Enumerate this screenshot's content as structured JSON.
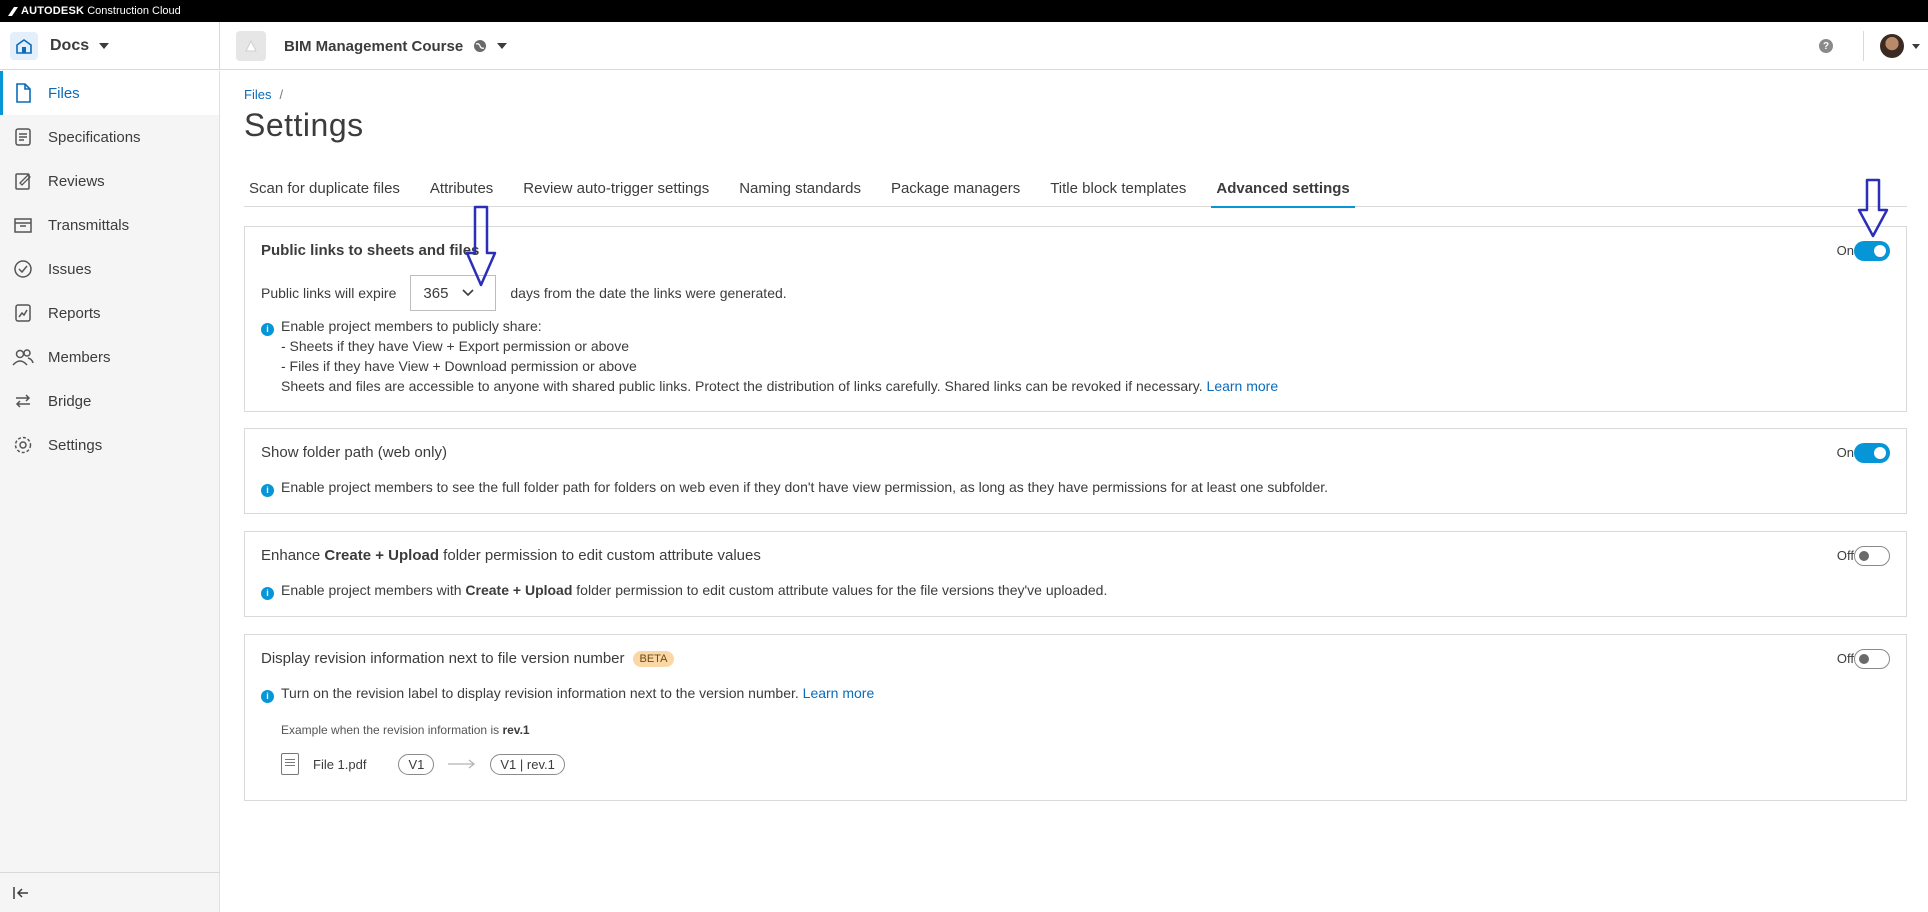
{
  "brand": {
    "strong": "AUTODESK",
    "rest": "Construction Cloud"
  },
  "header": {
    "app_name": "Docs",
    "project_name": "BIM Management Course"
  },
  "sidebar": {
    "items": [
      {
        "label": "Files",
        "icon": "file-icon"
      },
      {
        "label": "Specifications",
        "icon": "specifications-icon"
      },
      {
        "label": "Reviews",
        "icon": "reviews-icon"
      },
      {
        "label": "Transmittals",
        "icon": "transmittals-icon"
      },
      {
        "label": "Issues",
        "icon": "issues-icon"
      },
      {
        "label": "Reports",
        "icon": "reports-icon"
      },
      {
        "label": "Members",
        "icon": "members-icon"
      },
      {
        "label": "Bridge",
        "icon": "bridge-icon"
      },
      {
        "label": "Settings",
        "icon": "settings-icon"
      }
    ],
    "active": "Files"
  },
  "breadcrumb": {
    "root": "Files",
    "sep": "/"
  },
  "page_title": "Settings",
  "tabs": [
    "Scan for duplicate files",
    "Attributes",
    "Review auto-trigger settings",
    "Naming standards",
    "Package managers",
    "Title block templates",
    "Advanced settings"
  ],
  "active_tab": "Advanced settings",
  "cards": {
    "public_links": {
      "title": "Public links to sheets and files",
      "state_label": "On",
      "expire_prefix": "Public links will expire",
      "expire_value": "365",
      "expire_suffix": "days from the date the links were generated.",
      "info_line1": "Enable project members to publicly share:",
      "info_line2": "- Sheets if they have View + Export permission or above",
      "info_line3": "- Files if they have View + Download permission or above",
      "info_line4": "Sheets and files are accessible to anyone with shared public links. Protect the distribution of links carefully. Shared links can be revoked if necessary.",
      "learn_more": "Learn more"
    },
    "folder_path": {
      "title": "Show folder path (web only)",
      "state_label": "On",
      "info": "Enable project members to see the full folder path for folders on web even if they don't have view permission, as long as they have permissions for at least one subfolder."
    },
    "create_upload": {
      "title_pre": "Enhance ",
      "title_bold": "Create + Upload",
      "title_post": " folder permission to edit custom attribute values",
      "state_label": "Off",
      "info_pre": "Enable project members with ",
      "info_bold": "Create + Upload",
      "info_post": " folder permission to edit custom attribute values for the file versions they've uploaded."
    },
    "revision": {
      "title": "Display revision information next to file version number",
      "badge": "BETA",
      "state_label": "Off",
      "info": "Turn on the revision label to display revision information next to the version number.",
      "learn_more": "Learn more",
      "example_pre": "Example when the revision information is ",
      "example_value": "rev.1",
      "file_name": "File 1.pdf",
      "version_before": "V1",
      "version_after": "V1 | rev.1"
    }
  },
  "colors": {
    "accent": "#0696d7",
    "link": "#0a6cbb",
    "annotation_arrow": "#2b2fb8",
    "badge_bg": "#fbd7a6"
  }
}
